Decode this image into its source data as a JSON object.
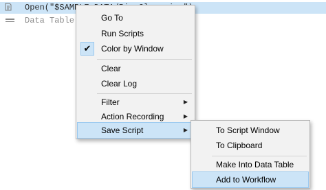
{
  "log": {
    "rows": [
      {
        "icon": "script-icon",
        "code": "Open(\"$SAMPLE_DATA/Big Class.jmp\")"
      },
      {
        "icon": "data-table-icon",
        "code": "Data Table(\"Big Class\")"
      }
    ]
  },
  "context_menu": {
    "items": [
      {
        "label": "Go To"
      },
      {
        "label": "Run Scripts"
      },
      {
        "label": "Color by Window",
        "checked": true
      },
      {
        "label": "Clear"
      },
      {
        "label": "Clear Log"
      },
      {
        "label": "Filter",
        "submenu": true
      },
      {
        "label": "Action Recording",
        "submenu": true
      },
      {
        "label": "Save Script",
        "submenu": true,
        "highlighted": true
      }
    ]
  },
  "submenu": {
    "items": [
      {
        "label": "To Script Window"
      },
      {
        "label": "To Clipboard"
      },
      {
        "label": "Make Into Data Table"
      },
      {
        "label": "Add to Workflow",
        "highlighted": true
      }
    ]
  },
  "colors": {
    "highlight": "#cce4f7",
    "highlight_border": "#99c8ef",
    "menu_bg": "#f2f2f2"
  }
}
